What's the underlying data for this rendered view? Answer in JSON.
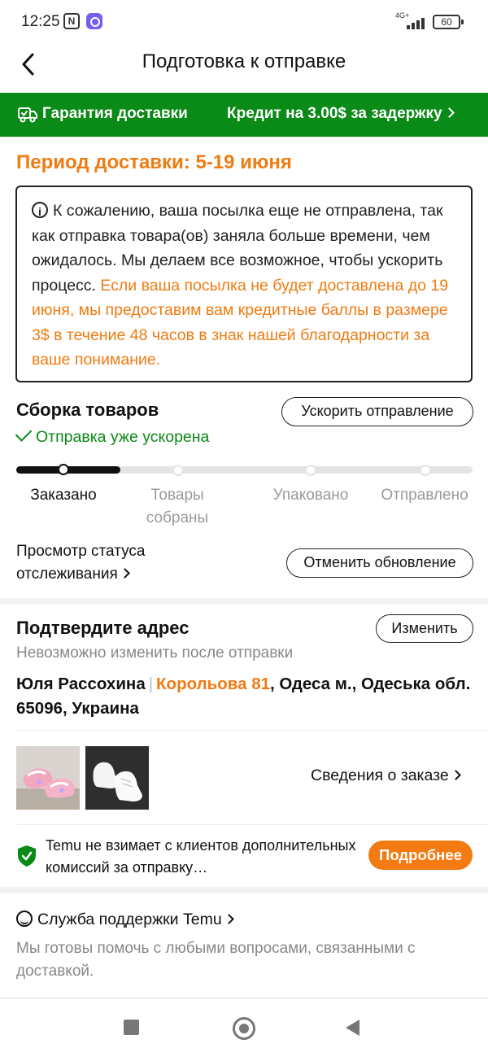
{
  "status_bar": {
    "time": "12:25",
    "nfc": "N",
    "network": "4G+",
    "battery": "60"
  },
  "header": {
    "title": "Подготовка к отправке"
  },
  "banner": {
    "left": "Гарантия доставки",
    "right": "Кредит на 3.00$ за задержку"
  },
  "delivery_period": "Период доставки: 5-19 июня",
  "notice": {
    "text": "К сожалению, ваша посылка еще не отправлена, так как отправка товара(ов) заняла больше времени, чем ожидалось. Мы делаем все возможное, чтобы ускорить процесс.",
    "highlight": "Если ваша посылка не будет доставлена до 19 июня, мы предоставим вам кредитные баллы в размере 3$ в течение 48 часов в знак нашей благодарности за ваше понимание."
  },
  "collection": {
    "title": "Сборка товаров",
    "speed_button": "Ускорить отправление",
    "speed_status": "Отправка уже ускорена",
    "steps": [
      "Заказано",
      "Товары собраны",
      "Упаковано",
      "Отправлено"
    ],
    "current_step": 1,
    "tracking_link": "Просмотр статуса отслеживания",
    "cancel_button": "Отменить обновление"
  },
  "address": {
    "title": "Подтвердите адрес",
    "change_button": "Изменить",
    "note": "Невозможно изменить после отправки",
    "name": "Юля Рассохина",
    "street": "Корольова 81",
    "rest": ", Одеса м., Одеська обл. 65096, Украина"
  },
  "order": {
    "details_link": "Сведения о заказе",
    "thumbnails": [
      "pink-sandals-image",
      "white-sneakers-image"
    ]
  },
  "fee": {
    "text": "Temu не взимает с клиентов дополнительных комиссий за отправку…",
    "more_button": "Подробнее"
  },
  "support": {
    "title": "Служба поддержки Temu",
    "text": "Мы готовы помочь с любыми вопросами, связанными с доставкой."
  },
  "colors": {
    "green": "#0a8a16",
    "orange": "#f07b12"
  }
}
